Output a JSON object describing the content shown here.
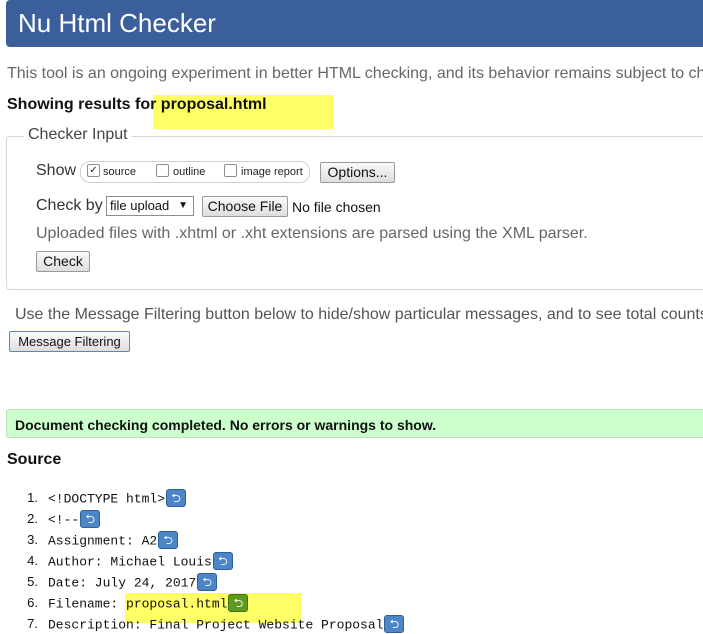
{
  "app": {
    "title": "Nu Html Checker"
  },
  "intro_text": "This tool is an ongoing experiment in better HTML checking, and its behavior remains subject to ch",
  "results": {
    "prefix": "Showing results for ",
    "filename": "proposal.html"
  },
  "checker_input": {
    "legend": "Checker Input",
    "show_label": "Show",
    "show_options": [
      {
        "label": "source",
        "checked": true
      },
      {
        "label": "outline",
        "checked": false
      },
      {
        "label": "image report",
        "checked": false
      }
    ],
    "options_button": "Options...",
    "check_by_label": "Check by",
    "check_by_value": "file upload",
    "choose_file_button": "Choose File",
    "no_file_text": "No file chosen",
    "xml_note": "Uploaded files with .xhtml or .xht extensions are parsed using the XML parser.",
    "check_button": "Check"
  },
  "filtering": {
    "note": "Use the Message Filtering button below to hide/show particular messages, and to see total counts",
    "button": "Message Filtering"
  },
  "status": {
    "message": "Document checking completed. No errors or warnings to show."
  },
  "source": {
    "title": "Source",
    "lines": [
      {
        "num": "1.",
        "text": "<!DOCTYPE html>"
      },
      {
        "num": "2.",
        "text": "<!--"
      },
      {
        "num": "3.",
        "text": "Assignment: A2"
      },
      {
        "num": "4.",
        "text": "Author: Michael Louis"
      },
      {
        "num": "5.",
        "text": "Date: July 24, 2017"
      },
      {
        "num": "6.",
        "text": "Filename: ",
        "highlight": "proposal.html"
      },
      {
        "num": "7.",
        "text": "Description: Final Project Website Proposal"
      }
    ]
  },
  "colors": {
    "header": "#3a5f9b",
    "highlight": "#ffff66",
    "success": "#ccffcc",
    "return_icon": "#4d86c6",
    "return_icon_active": "#5d9b20"
  }
}
